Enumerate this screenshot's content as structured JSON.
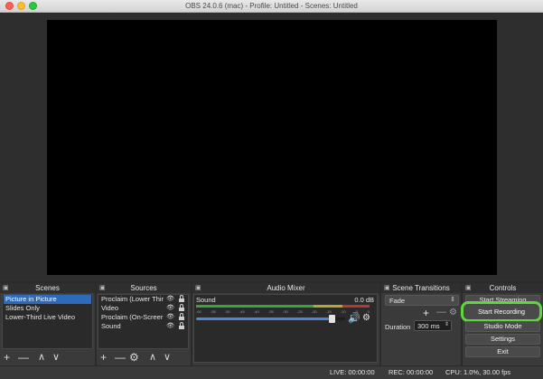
{
  "window": {
    "title": "OBS 24.0.6 (mac) - Profile: Untitled - Scenes: Untitled"
  },
  "docks": {
    "scenes": {
      "title": "Scenes",
      "items": [
        {
          "label": "Picture in Picture",
          "selected": true
        },
        {
          "label": "Slides Only",
          "selected": false
        },
        {
          "label": "Lower-Third Live Video",
          "selected": false
        }
      ]
    },
    "sources": {
      "title": "Sources",
      "items": [
        {
          "label": "Proclaim (Lower Thir"
        },
        {
          "label": "Video"
        },
        {
          "label": "Proclaim (On-Screer"
        },
        {
          "label": "Sound"
        }
      ]
    },
    "audio_mixer": {
      "title": "Audio Mixer",
      "track": {
        "name": "Sound",
        "level": "0.0 dB",
        "volume_fraction": 0.93
      },
      "ticks": [
        "-60",
        "-55",
        "-50",
        "-45",
        "-40",
        "-35",
        "-30",
        "-25",
        "-20",
        "-15",
        "-10",
        "-5",
        "0"
      ]
    },
    "transitions": {
      "title": "Scene Transitions",
      "selected": "Fade",
      "duration_label": "Duration",
      "duration_value": "300 ms"
    },
    "controls": {
      "title": "Controls",
      "buttons": {
        "start_streaming": "Start Streaming",
        "start_recording": "Start Recording",
        "studio_mode": "Studio Mode",
        "settings": "Settings",
        "exit": "Exit"
      }
    }
  },
  "status": {
    "live": "LIVE: 00:00:00",
    "rec": "REC: 00:00:00",
    "cpu": "CPU: 1.0%, 30.00 fps"
  },
  "colors": {
    "accent_selection": "#2f6ab8",
    "highlight_ring": "#5ed63e",
    "meter_green": "#3aa33a",
    "meter_yellow": "#b7a72c",
    "meter_red": "#b23a2e"
  }
}
